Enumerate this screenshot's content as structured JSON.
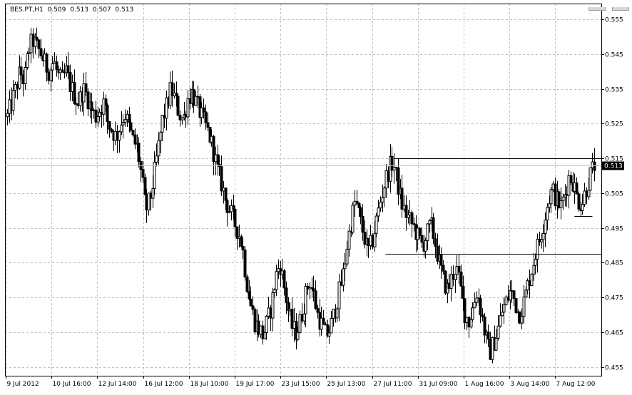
{
  "header": {
    "symbol": "BES.PT,H1",
    "open": "0.509",
    "high": "0.513",
    "low": "0.507",
    "close": "0.513"
  },
  "colors": {
    "background": "#ffffff",
    "grid": "#c0c0c0",
    "candle": "#000000",
    "bid_line": "#c0c0c0",
    "price_badge_bg": "#000000",
    "price_badge_text": "#ffffff"
  },
  "chart_data": {
    "type": "candlestick",
    "timeframe": "H1",
    "symbol": "BES.PT",
    "ylim": [
      0.4525,
      0.5595
    ],
    "y_ticks": [
      "0.555",
      "0.545",
      "0.535",
      "0.525",
      "0.515",
      "0.505",
      "0.495",
      "0.485",
      "0.475",
      "0.465",
      "0.455"
    ],
    "x_ticks": [
      "9 Jul 2012",
      "10 Jul 16:00",
      "12 Jul 14:00",
      "16 Jul 12:00",
      "18 Jul 10:00",
      "19 Jul 17:00",
      "23 Jul 15:00",
      "25 Jul 13:00",
      "27 Jul 11:00",
      "31 Jul 09:00",
      "1 Aug 16:00",
      "3 Aug 14:00",
      "7 Aug 12:00"
    ],
    "grid": true,
    "last_price": "0.513",
    "close_path": [
      0.527,
      0.531,
      0.535,
      0.54,
      0.537,
      0.546,
      0.549,
      0.547,
      0.545,
      0.542,
      0.54,
      0.543,
      0.539,
      0.537,
      0.54,
      0.536,
      0.533,
      0.531,
      0.535,
      0.533,
      0.529,
      0.527,
      0.529,
      0.531,
      0.525,
      0.523,
      0.521,
      0.525,
      0.528,
      0.524,
      0.52,
      0.518,
      0.51,
      0.5,
      0.503,
      0.51,
      0.518,
      0.526,
      0.53,
      0.535,
      0.532,
      0.528,
      0.526,
      0.532,
      0.534,
      0.531,
      0.528,
      0.525,
      0.522,
      0.518,
      0.512,
      0.508,
      0.503,
      0.5,
      0.497,
      0.494,
      0.49,
      0.48,
      0.473,
      0.468,
      0.466,
      0.464,
      0.468,
      0.473,
      0.481,
      0.485,
      0.478,
      0.471,
      0.466,
      0.465,
      0.469,
      0.475,
      0.48,
      0.476,
      0.47,
      0.467,
      0.464,
      0.466,
      0.471,
      0.476,
      0.481,
      0.49,
      0.497,
      0.503,
      0.498,
      0.493,
      0.488,
      0.491,
      0.497,
      0.503,
      0.508,
      0.512,
      0.514,
      0.508,
      0.502,
      0.499,
      0.497,
      0.495,
      0.492,
      0.49,
      0.493,
      0.496,
      0.491,
      0.485,
      0.48,
      0.477,
      0.481,
      0.484,
      0.478,
      0.471,
      0.468,
      0.472,
      0.477,
      0.471,
      0.464,
      0.459,
      0.462,
      0.466,
      0.471,
      0.474,
      0.477,
      0.474,
      0.47,
      0.473,
      0.478,
      0.483,
      0.488,
      0.492,
      0.497,
      0.503,
      0.506,
      0.503,
      0.501,
      0.505,
      0.51,
      0.508,
      0.503,
      0.502,
      0.506,
      0.51,
      0.513
    ],
    "horizontal_lines": [
      {
        "price": 0.515,
        "x_from": 0.653,
        "x_to": 1.0
      },
      {
        "price": 0.4875,
        "x_from": 0.638,
        "x_to": 1.0
      },
      {
        "price": 0.4985,
        "x_from": 0.955,
        "x_to": 0.985
      }
    ]
  }
}
